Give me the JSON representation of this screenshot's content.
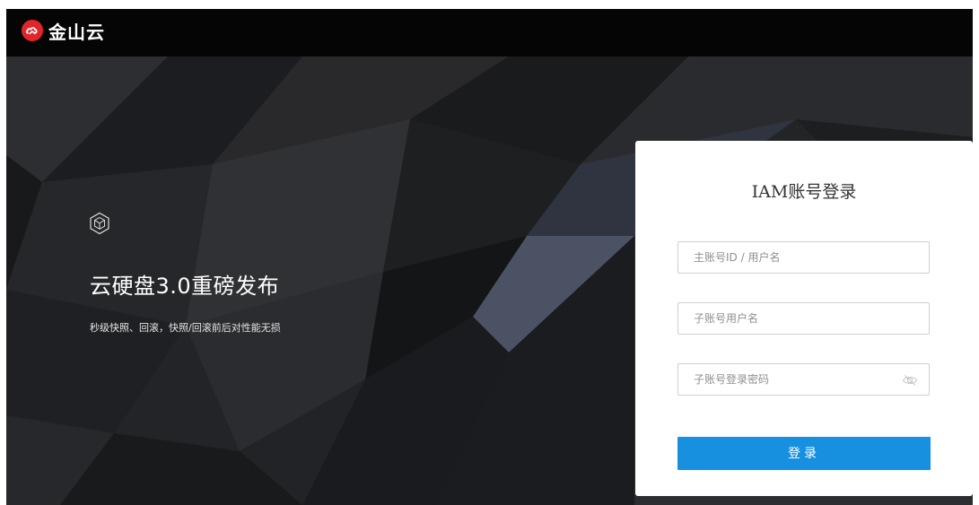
{
  "brand": {
    "name": "金山云",
    "accent_color": "#e2242b",
    "topbar_color": "#050505"
  },
  "promo": {
    "icon": "cube-hexagon-icon",
    "title": "云硬盘3.0重磅发布",
    "subtitle": "秒级快照、回滚，快照/回滚前后对性能无损"
  },
  "login": {
    "title": "IAM账号登录",
    "main_account": {
      "placeholder": "主账号ID / 用户名",
      "value": ""
    },
    "sub_account": {
      "placeholder": "子账号用户名",
      "value": ""
    },
    "password": {
      "placeholder": "子账号登录密码",
      "value": "",
      "toggle_icon": "eye-icon"
    },
    "submit_label": "登录",
    "submit_color": "#1890e0"
  }
}
